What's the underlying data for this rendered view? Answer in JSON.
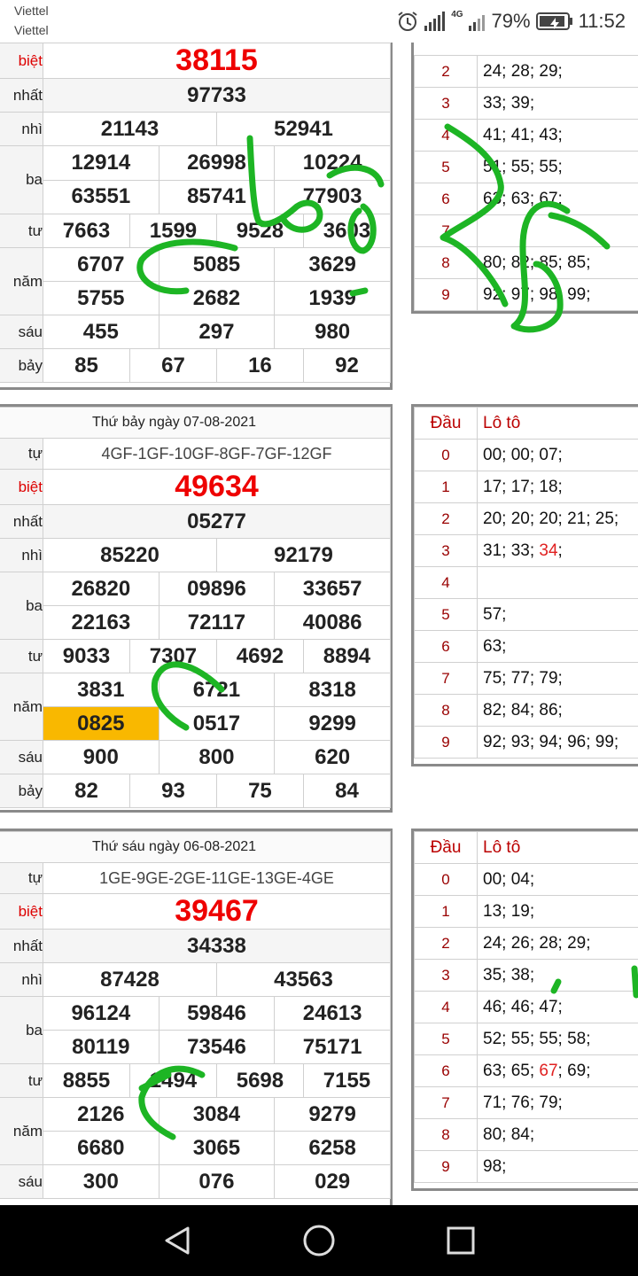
{
  "status": {
    "carrier1": "Viettel",
    "carrier2": "Viettel",
    "network": "4G",
    "battery": "79%",
    "time": "11:52",
    "icons": [
      "alarm-icon",
      "signal-icon",
      "network-4g-icon",
      "signal-icon",
      "battery-icon"
    ]
  },
  "labels": {
    "db": "biệt",
    "g1": "nhất",
    "g2": "nhì",
    "g3": "ba",
    "g4": "tư",
    "g5": "năm",
    "g6": "sáu",
    "g7": "bảy",
    "code": "tự",
    "dau": "Đầu",
    "loto": "Lô tô"
  },
  "block1": {
    "db": "38115",
    "g1": "97733",
    "g2": [
      "21143",
      "52941"
    ],
    "g3": [
      "12914",
      "26998",
      "10224",
      "63551",
      "85741",
      "77903"
    ],
    "g4": [
      "7663",
      "1599",
      "9528",
      "3603"
    ],
    "g5": [
      "6707",
      "5085",
      "3629",
      "5755",
      "2682",
      "1939"
    ],
    "g6": [
      "455",
      "297",
      "980"
    ],
    "g7": [
      "85",
      "67",
      "16",
      "92"
    ]
  },
  "loto1": [
    {
      "d": "2",
      "v": "24; 28; 29;"
    },
    {
      "d": "3",
      "v": "33; 39;"
    },
    {
      "d": "4",
      "v": "41; 41; 43;"
    },
    {
      "d": "5",
      "v": "51; 55; 55;"
    },
    {
      "d": "6",
      "v": "63; 63; 67;"
    },
    {
      "d": "7",
      "v": ""
    },
    {
      "d": "8",
      "v": "80; 82; 85; 85;"
    },
    {
      "d": "9",
      "v": "92; 97; 98; 99;"
    }
  ],
  "block2": {
    "date": "Thứ bảy ngày 07-08-2021",
    "code": "4GF-1GF-10GF-8GF-7GF-12GF",
    "db": "49634",
    "g1": "05277",
    "g2": [
      "85220",
      "92179"
    ],
    "g3": [
      "26820",
      "09896",
      "33657",
      "22163",
      "72117",
      "40086"
    ],
    "g4": [
      "9033",
      "7307",
      "4692",
      "8894"
    ],
    "g5": [
      "3831",
      "6721",
      "8318",
      "0825",
      "0517",
      "9299"
    ],
    "g6": [
      "900",
      "800",
      "620"
    ],
    "g7": [
      "82",
      "93",
      "75",
      "84"
    ]
  },
  "loto2": [
    {
      "d": "0",
      "v": "00; 00; 07;"
    },
    {
      "d": "1",
      "v": "17; 17; 18;"
    },
    {
      "d": "2",
      "v": "20; 20; 20; 21; 25;"
    },
    {
      "d": "3",
      "v": "31; 33; ",
      "r": "34",
      ";": ";"
    },
    {
      "d": "4",
      "v": ""
    },
    {
      "d": "5",
      "v": "57;"
    },
    {
      "d": "6",
      "v": "63;"
    },
    {
      "d": "7",
      "v": "75; 77; 79;"
    },
    {
      "d": "8",
      "v": "82; 84; 86;"
    },
    {
      "d": "9",
      "v": "92; 93; 94; 96; 99;"
    }
  ],
  "block3": {
    "date": "Thứ sáu ngày 06-08-2021",
    "code": "1GE-9GE-2GE-11GE-13GE-4GE",
    "db": "39467",
    "g1": "34338",
    "g2": [
      "87428",
      "43563"
    ],
    "g3": [
      "96124",
      "59846",
      "24613",
      "80119",
      "73546",
      "75171"
    ],
    "g4": [
      "8855",
      "1494",
      "5698",
      "7155"
    ],
    "g5": [
      "2126",
      "3084",
      "9279",
      "6680",
      "3065",
      "6258"
    ],
    "g6": [
      "300",
      "076",
      "029"
    ]
  },
  "loto3": [
    {
      "d": "0",
      "v": "00; 04;"
    },
    {
      "d": "1",
      "v": "13; 19;"
    },
    {
      "d": "2",
      "v": "24; 26; 28; 29;"
    },
    {
      "d": "3",
      "v": "35; 38;"
    },
    {
      "d": "4",
      "v": "46; 46; 47;"
    },
    {
      "d": "5",
      "v": "52; 55; 55; 58;"
    },
    {
      "d": "6",
      "v": "63; 65; ",
      "r": "67",
      "v2": "; 69;"
    },
    {
      "d": "7",
      "v": "71; 76; 79;"
    },
    {
      "d": "8",
      "v": "80; 84;"
    },
    {
      "d": "9",
      "v": "98;"
    }
  ],
  "colors": {
    "red": "#e00000",
    "highlight": "#f9b800",
    "annotation": "#1db524"
  }
}
